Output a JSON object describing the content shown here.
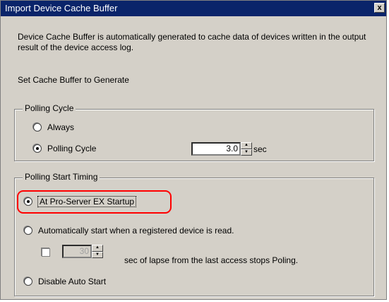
{
  "window": {
    "title": "Import Device Cache Buffer",
    "close_label": "x"
  },
  "description": "Device Cache Buffer is automatically generated to cache data of devices written in the output result of the device access log.",
  "subheading": "Set Cache Buffer to Generate",
  "polling_cycle": {
    "group_label": "Polling Cycle",
    "options": [
      {
        "label": "Always",
        "checked": false
      },
      {
        "label": "Polling Cycle",
        "checked": true
      }
    ],
    "value": "3.0",
    "unit": "sec"
  },
  "polling_start": {
    "group_label": "Polling Start Timing",
    "options": [
      {
        "label": "At Pro-Server EX Startup",
        "checked": true
      },
      {
        "label": "Automatically start when a registered device is read.",
        "checked": false
      },
      {
        "label": "Disable Auto Start",
        "checked": false
      }
    ],
    "lapse_value": "30",
    "lapse_text": "sec of lapse from the last access stops Poling.",
    "lapse_checked": false
  }
}
